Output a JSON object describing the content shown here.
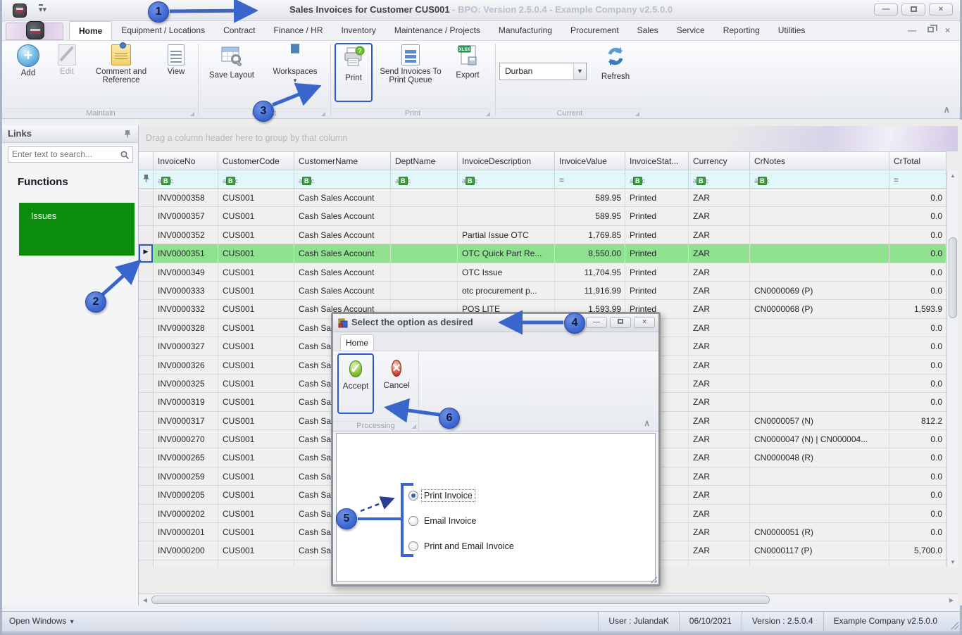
{
  "titlebar": {
    "title": "Sales Invoices for Customer CUS001",
    "subtitle": " - BPO: Version 2.5.0.4 - Example Company v2.5.0.0"
  },
  "tabs": {
    "active": "Home",
    "items": [
      "Home",
      "Equipment / Locations",
      "Contract",
      "Finance / HR",
      "Inventory",
      "Maintenance / Projects",
      "Manufacturing",
      "Procurement",
      "Sales",
      "Service",
      "Reporting",
      "Utilities"
    ]
  },
  "ribbon": {
    "maintain": {
      "label": "Maintain",
      "add": "Add",
      "edit": "Edit",
      "comment": "Comment and Reference",
      "view": "View"
    },
    "format": {
      "label": "Format",
      "save_layout": "Save Layout",
      "workspaces": "Workspaces"
    },
    "print": {
      "label": "Print",
      "print": "Print",
      "send": "Send Invoices To Print Queue",
      "export": "Export"
    },
    "current": {
      "label": "Current",
      "site": "Durban",
      "refresh": "Refresh"
    }
  },
  "sidebar": {
    "title": "Links",
    "search_placeholder": "Enter text to search...",
    "section": "Functions",
    "items": [
      {
        "label": "Issues"
      }
    ]
  },
  "grid": {
    "groupby_hint": "Drag a column header here to group by that column",
    "columns": [
      {
        "label": "InvoiceNo",
        "filter": "abc"
      },
      {
        "label": "CustomerCode",
        "filter": "abc"
      },
      {
        "label": "CustomerName",
        "filter": "abc"
      },
      {
        "label": "DeptName",
        "filter": "abc"
      },
      {
        "label": "InvoiceDescription",
        "filter": "abc"
      },
      {
        "label": "InvoiceValue",
        "filter": "eq"
      },
      {
        "label": "InvoiceStat...",
        "filter": "abc"
      },
      {
        "label": "Currency",
        "filter": "abc"
      },
      {
        "label": "CrNotes",
        "filter": "abc"
      },
      {
        "label": "CrTotal",
        "filter": "eq"
      }
    ],
    "rows": [
      {
        "no": "INV0000358",
        "code": "CUS001",
        "name": "Cash Sales Account",
        "dept": "",
        "desc": "",
        "value": "589.95",
        "status": "Printed",
        "currency": "ZAR",
        "crnotes": "",
        "crtotal": "0.0"
      },
      {
        "no": "INV0000357",
        "code": "CUS001",
        "name": "Cash Sales Account",
        "dept": "",
        "desc": "",
        "value": "589.95",
        "status": "Printed",
        "currency": "ZAR",
        "crnotes": "",
        "crtotal": "0.0"
      },
      {
        "no": "INV0000352",
        "code": "CUS001",
        "name": "Cash Sales Account",
        "dept": "",
        "desc": "Partial Issue OTC",
        "value": "1,769.85",
        "status": "Printed",
        "currency": "ZAR",
        "crnotes": "",
        "crtotal": "0.0"
      },
      {
        "no": "INV0000351",
        "code": "CUS001",
        "name": "Cash Sales Account",
        "dept": "",
        "desc": "OTC Quick Part Re...",
        "value": "8,550.00",
        "status": "Printed",
        "currency": "ZAR",
        "crnotes": "",
        "crtotal": "0.0",
        "selected": true
      },
      {
        "no": "INV0000349",
        "code": "CUS001",
        "name": "Cash Sales Account",
        "dept": "",
        "desc": "OTC Issue",
        "value": "11,704.95",
        "status": "Printed",
        "currency": "ZAR",
        "crnotes": "",
        "crtotal": "0.0"
      },
      {
        "no": "INV0000333",
        "code": "CUS001",
        "name": "Cash Sales Account",
        "dept": "",
        "desc": "otc procurement p...",
        "value": "11,916.99",
        "status": "Printed",
        "currency": "ZAR",
        "crnotes": "CN0000069 (P)",
        "crtotal": "0.0"
      },
      {
        "no": "INV0000332",
        "code": "CUS001",
        "name": "Cash Sales Account",
        "dept": "",
        "desc": "POS LITE",
        "value": "1,593.99",
        "status": "Printed",
        "currency": "ZAR",
        "crnotes": "CN0000068 (P)",
        "crtotal": "1,593.9"
      },
      {
        "no": "INV0000328",
        "code": "CUS001",
        "name": "Cash Sales Account",
        "dept": "",
        "desc": "",
        "value": "",
        "status": "",
        "currency": "ZAR",
        "crnotes": "",
        "crtotal": "0.0"
      },
      {
        "no": "INV0000327",
        "code": "CUS001",
        "name": "Cash Sales Account",
        "dept": "",
        "desc": "",
        "value": "",
        "status": "",
        "currency": "ZAR",
        "crnotes": "",
        "crtotal": "0.0"
      },
      {
        "no": "INV0000326",
        "code": "CUS001",
        "name": "Cash Sales Account",
        "dept": "",
        "desc": "",
        "value": "",
        "status": "",
        "currency": "ZAR",
        "crnotes": "",
        "crtotal": "0.0"
      },
      {
        "no": "INV0000325",
        "code": "CUS001",
        "name": "Cash Sales Account",
        "dept": "",
        "desc": "",
        "value": "",
        "status": "",
        "currency": "ZAR",
        "crnotes": "",
        "crtotal": "0.0"
      },
      {
        "no": "INV0000319",
        "code": "CUS001",
        "name": "Cash Sales Account",
        "dept": "",
        "desc": "",
        "value": "",
        "status": "",
        "currency": "ZAR",
        "crnotes": "",
        "crtotal": "0.0"
      },
      {
        "no": "INV0000317",
        "code": "CUS001",
        "name": "Cash Sales Account",
        "dept": "",
        "desc": "",
        "value": "",
        "status": "",
        "currency": "ZAR",
        "crnotes": "CN0000057 (N)",
        "crtotal": "812.2"
      },
      {
        "no": "INV0000270",
        "code": "CUS001",
        "name": "Cash Sales Account",
        "dept": "",
        "desc": "",
        "value": "",
        "status": "",
        "currency": "ZAR",
        "crnotes": "CN0000047 (N) | CN000004...",
        "crtotal": "0.0"
      },
      {
        "no": "INV0000265",
        "code": "CUS001",
        "name": "Cash Sales Account",
        "dept": "",
        "desc": "",
        "value": "",
        "status": "",
        "currency": "ZAR",
        "crnotes": "CN0000048 (R)",
        "crtotal": "0.0"
      },
      {
        "no": "INV0000259",
        "code": "CUS001",
        "name": "Cash Sales Account",
        "dept": "",
        "desc": "",
        "value": "",
        "status": "",
        "currency": "ZAR",
        "crnotes": "",
        "crtotal": "0.0"
      },
      {
        "no": "INV0000205",
        "code": "CUS001",
        "name": "Cash Sales Account",
        "dept": "",
        "desc": "",
        "value": "",
        "status": "",
        "currency": "ZAR",
        "crnotes": "",
        "crtotal": "0.0"
      },
      {
        "no": "INV0000202",
        "code": "CUS001",
        "name": "Cash Sales Account",
        "dept": "",
        "desc": "",
        "value": "",
        "status": "",
        "currency": "ZAR",
        "crnotes": "",
        "crtotal": "0.0"
      },
      {
        "no": "INV0000201",
        "code": "CUS001",
        "name": "Cash Sales Account",
        "dept": "",
        "desc": "",
        "value": "",
        "status": "",
        "currency": "ZAR",
        "crnotes": "CN0000051 (R)",
        "crtotal": "0.0"
      },
      {
        "no": "INV0000200",
        "code": "CUS001",
        "name": "Cash Sales Account",
        "dept": "",
        "desc": "",
        "value": "",
        "status": "",
        "currency": "ZAR",
        "crnotes": "CN0000117 (P)",
        "crtotal": "5,700.0"
      }
    ]
  },
  "dialog": {
    "title": "Select the option as desired",
    "tab": "Home",
    "accept": "Accept",
    "cancel": "Cancel",
    "group": "Processing",
    "options": [
      {
        "label": "Print Invoice",
        "selected": true
      },
      {
        "label": "Email Invoice",
        "selected": false
      },
      {
        "label": "Print and Email Invoice",
        "selected": false
      }
    ]
  },
  "statusbar": {
    "open_windows": "Open Windows",
    "segments": [
      "User : JulandaK",
      "06/10/2021",
      "Version : 2.5.0.4",
      "Example Company v2.5.0.0"
    ]
  },
  "callouts": [
    "1",
    "2",
    "3",
    "4",
    "5",
    "6"
  ]
}
